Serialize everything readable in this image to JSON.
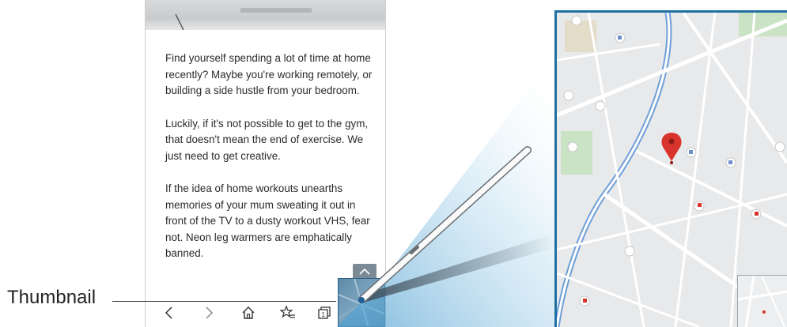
{
  "article": {
    "paragraphs": [
      "Find yourself spending a lot of time at home recently? Maybe you're working remotely, or building a side hustle from your bedroom.",
      "Luckily, if it's not possible to get to the gym, that doesn't mean the end of exercise. We just need to get creative.",
      "If the idea of home workouts unearths memories of your mum sweating it out in front of the TV to a dusty workout VHS, fear not. Neon leg warmers are emphatically banned."
    ]
  },
  "navbar": {
    "icons": [
      "back-icon",
      "forward-icon",
      "home-icon",
      "bookmark-star-icon",
      "tabs-icon"
    ]
  },
  "callout": {
    "label": "Thumbnail"
  },
  "colors": {
    "accent": "#1f6fa3",
    "map_marker": "#d9342b",
    "map_road": "#ffffff",
    "map_water": "#6f9fd8",
    "map_park": "#c9e3c4"
  }
}
